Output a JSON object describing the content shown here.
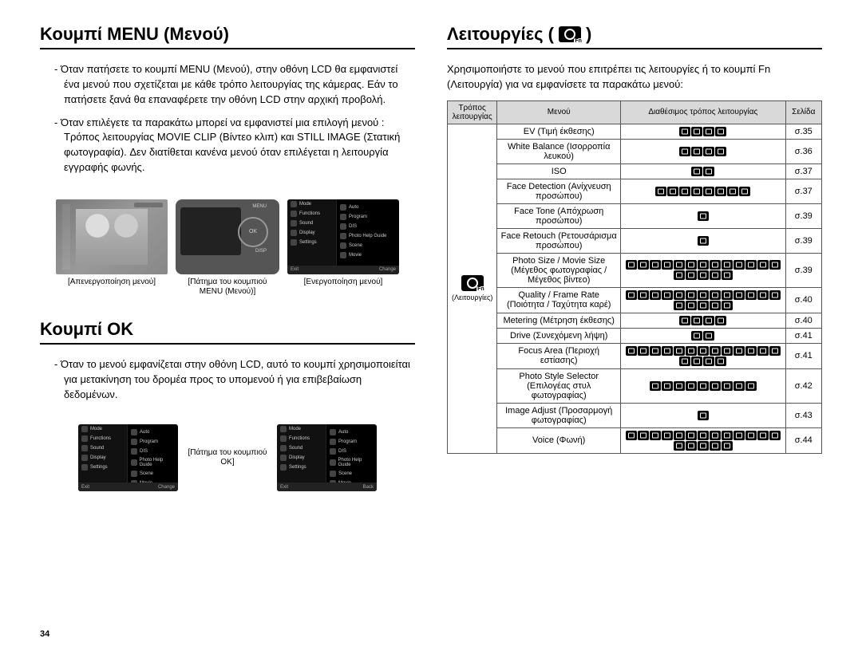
{
  "page_number": "34",
  "left": {
    "h_menu": "Κουμπί MENU (Μενού)",
    "p1": "- Όταν πατήσετε το κουμπί MENU (Μενού), στην οθόνη LCD θα εμφανιστεί ένα μενού που σχετίζεται με κάθε τρόπο λειτουργίας της κάμερας. Εάν το πατήσετε ξανά θα επαναφέρετε την οθόνη LCD στην αρχική προβολή.",
    "p2": "- Όταν επιλέγετε τα παρακάτω μπορεί να εμφανιστεί μια επιλογή μενού : Τρόπος λειτουργίας MOVIE CLIP (Βίντεο κλιπ) και STILL IMAGE (Στατική φωτογραφία). Δεν διατίθεται κανένα μενού όταν επιλέγεται η λειτουργία εγγραφής φωνής.",
    "caption_off": "[Απενεργοποίηση μενού]",
    "caption_on": "[Ενεργοποίηση μενού]",
    "arrow_label": "[Πάτημα του κουμπιού MENU (Μενού)]",
    "h_ok": "Κουμπί OK",
    "p_ok": "- Όταν το μενού εμφανίζεται στην οθόνη LCD, αυτό το κουμπί χρησιμοποιείται για μετακίνηση του δρομέα προς το υπομενού ή για επιβεβαίωση δεδομένων.",
    "arrow_ok": "[Πάτημα του κουμπιού OK]",
    "lcd_items_left": [
      "Mode",
      "Functions",
      "Sound",
      "Display",
      "Settings"
    ],
    "lcd_items_right": [
      "Auto",
      "Program",
      "DIS",
      "Photo Help Guide",
      "Scene",
      "Movie"
    ],
    "lcd_footer_exit": "Exit",
    "lcd_footer_change": "Change",
    "lcd_footer_back": "Back",
    "cam_menu": "MENU",
    "cam_disp": "DISP",
    "cam_ok": "OK"
  },
  "right": {
    "h_func": "Λειτουργίες (",
    "h_func_tail": ")",
    "p1": "Χρησιμοποιήστε το μενού που επιτρέπει τις λειτουργίες ή το κουμπί Fn (Λειτουργία) για να εμφανίσετε τα παρακάτω μενού:",
    "headers": {
      "op": "Τρόπος λειτουργίας",
      "menu": "Μενού",
      "modes": "Διαθέσιμος τρόπος λειτουργίας",
      "page": "Σελίδα"
    },
    "op_label": "(Λειτουργίες)",
    "rows": [
      {
        "menu": "EV (Τιμή έκθεσης)",
        "icons": 4,
        "page": "σ.35"
      },
      {
        "menu": "White Balance (Ισορροπία λευκού)",
        "icons": 4,
        "page": "σ.36"
      },
      {
        "menu": "ISO",
        "icons": 2,
        "page": "σ.37"
      },
      {
        "menu": "Face Detection (Ανίχνευση προσώπου)",
        "icons": 8,
        "page": "σ.37"
      },
      {
        "menu": "Face Tone (Απόχρωση προσώπου)",
        "icons": 1,
        "page": "σ.39"
      },
      {
        "menu": "Face Retouch (Ρετουσάρισμα προσώπου)",
        "icons": 1,
        "page": "σ.39"
      },
      {
        "menu": "Photo Size / Movie Size (Μέγεθος φωτογραφίας / Μέγεθος βίντεο)",
        "icons": 18,
        "page": "σ.39"
      },
      {
        "menu": "Quality / Frame Rate (Ποιότητα / Ταχύτητα καρέ)",
        "icons": 18,
        "page": "σ.40"
      },
      {
        "menu": "Metering (Μέτρηση έκθεσης)",
        "icons": 4,
        "page": "σ.40"
      },
      {
        "menu": "Drive (Συνεχόμενη λήψη)",
        "icons": 2,
        "page": "σ.41"
      },
      {
        "menu": "Focus Area (Περιοχή εστίασης)",
        "icons": 17,
        "page": "σ.41"
      },
      {
        "menu": "Photo Style Selector (Επιλογέας στυλ φωτογραφίας)",
        "icons": 9,
        "page": "σ.42"
      },
      {
        "menu": "Image Adjust (Προσαρμογή φωτογραφίας)",
        "icons": 1,
        "page": "σ.43"
      },
      {
        "menu": "Voice (Φωνή)",
        "icons": 18,
        "page": "σ.44"
      }
    ]
  }
}
